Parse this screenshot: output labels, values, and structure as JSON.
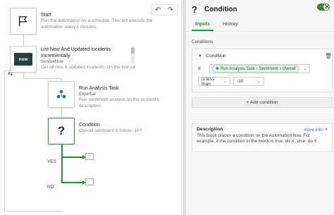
{
  "canvas": {
    "undo_icon": "undo-icon",
    "redo_icon": "redo-icon",
    "steps": [
      {
        "title": "Start",
        "sub": "Run the automation no a schedule. This will execute the automation every x minutes.",
        "icon": "flag-icon"
      },
      {
        "title": "List New And Updated Incidents Incrementally",
        "app": "ServiceNow",
        "sub": "Get all new & updated incidents. On the first run,...",
        "icon": "now"
      },
      {
        "title": "Run Analysis Task",
        "app": "Expert.ai",
        "sub": "Run sentiment analysis on the incident's description.",
        "icon": "expertai-icon"
      },
      {
        "title": "Condition",
        "sub": "Overall sentiment is below -10?",
        "icon": "question-icon"
      }
    ],
    "now_logo": "now",
    "branches": {
      "yes": "YES",
      "no": "NO"
    }
  },
  "panel": {
    "icon": "?",
    "title": "Condition",
    "tabs": [
      {
        "label": "Inputs",
        "active": true
      },
      {
        "label": "History",
        "active": false
      }
    ],
    "conditions_label": "Conditions",
    "condition": {
      "header": "Condition",
      "if_label": "If",
      "path": [
        "Run Analysis Task",
        "Sentiment",
        "Overall"
      ],
      "operator": "is less than",
      "value": "-10"
    },
    "add_condition": "+ Add condition",
    "description": {
      "title": "Description",
      "more_info": "more info",
      "text": "This block places a condition on the Automation flow. For example, if the condition in the block is true, do X, else, do Y."
    }
  },
  "colors": {
    "accent": "#2e8b3a",
    "link": "#2a6db5",
    "servicenow": "#293e40"
  }
}
